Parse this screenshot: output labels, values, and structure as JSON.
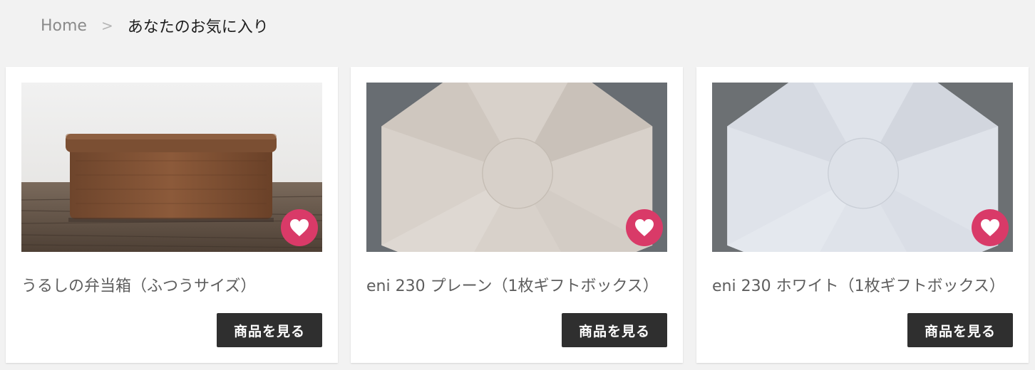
{
  "breadcrumb": {
    "home": "Home",
    "separator": ">",
    "current": "あなたのお気に入り"
  },
  "colors": {
    "accent_heart": "#d93a68",
    "button_bg": "#2f2f2f",
    "page_bg": "#f2f2f2"
  },
  "products": [
    {
      "title": "うるしの弁当箱（ふつうサイズ）",
      "button_label": "商品を見る",
      "favorite_icon": "heart-icon"
    },
    {
      "title": "eni 230 プレーン（1枚ギフトボックス）",
      "button_label": "商品を見る",
      "favorite_icon": "heart-icon"
    },
    {
      "title": "eni 230 ホワイト（1枚ギフトボックス）",
      "button_label": "商品を見る",
      "favorite_icon": "heart-icon"
    }
  ]
}
